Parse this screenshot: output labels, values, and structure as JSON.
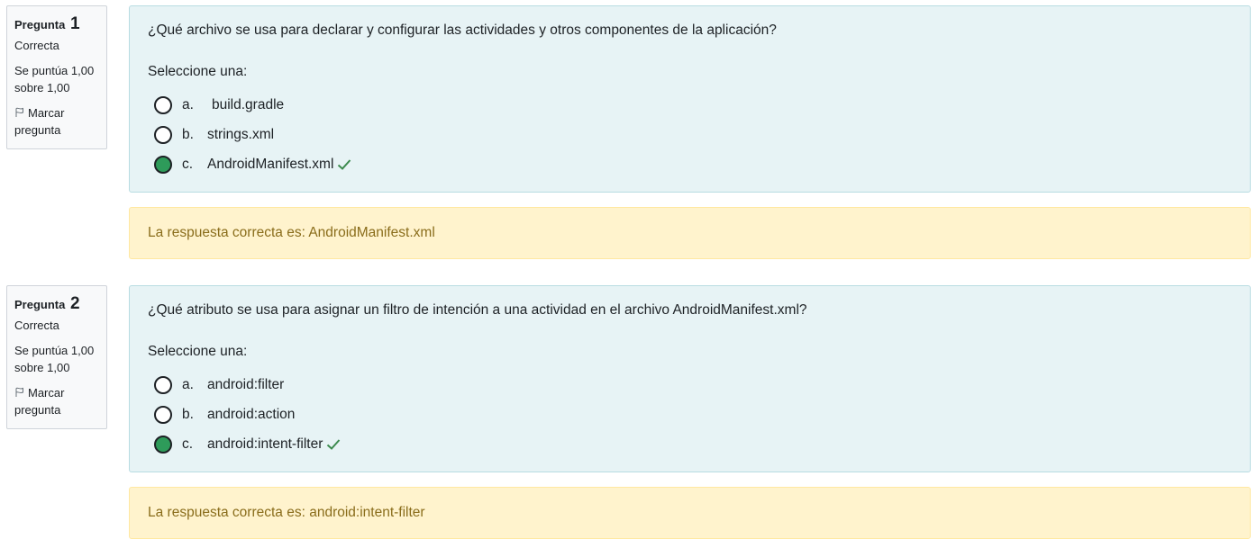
{
  "questions": [
    {
      "label": "Pregunta",
      "number": "1",
      "state": "Correcta",
      "grade_line1": "Se puntúa 1,00",
      "grade_line2": "sobre 1,00",
      "flag_line1": "Marcar",
      "flag_line2": "pregunta",
      "text": "¿Qué archivo se usa para declarar y configurar las actividades y otros componentes de la aplicación?",
      "prompt": "Seleccione una:",
      "answers": [
        {
          "letter": "a.",
          "text": "build.gradle",
          "checked": false
        },
        {
          "letter": "b.",
          "text": "strings.xml",
          "checked": false
        },
        {
          "letter": "c.",
          "text": "AndroidManifest.xml",
          "checked": true
        }
      ],
      "feedback": "La respuesta correcta es: AndroidManifest.xml"
    },
    {
      "label": "Pregunta",
      "number": "2",
      "state": "Correcta",
      "grade_line1": "Se puntúa 1,00",
      "grade_line2": "sobre 1,00",
      "flag_line1": "Marcar",
      "flag_line2": "pregunta",
      "text": "¿Qué atributo se usa para asignar un filtro de intención a una actividad en el archivo AndroidManifest.xml?",
      "prompt": "Seleccione una:",
      "answers": [
        {
          "letter": "a.",
          "text": "android:filter",
          "checked": false
        },
        {
          "letter": "b.",
          "text": "android:action",
          "checked": false
        },
        {
          "letter": "c.",
          "text": "android:intent-filter",
          "checked": true
        }
      ],
      "feedback": "La respuesta correcta es: android:intent-filter"
    }
  ],
  "colors": {
    "formulation_bg": "#e7f3f5",
    "feedback_bg": "#fff3cd",
    "feedback_text": "#8a6d1b",
    "correct_green": "#2e9b5a",
    "check_green": "#3c8a4e"
  },
  "icons": {
    "flag": "flag-icon",
    "correct": "check-icon"
  }
}
